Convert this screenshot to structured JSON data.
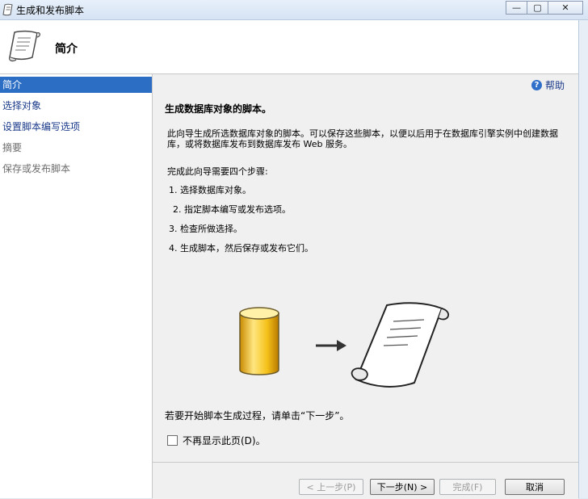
{
  "window": {
    "title": "生成和发布脚本",
    "controls": {
      "minimize": "—",
      "maximize": "▢",
      "close": "✕"
    }
  },
  "header": {
    "title": "简介"
  },
  "nav": {
    "items": [
      {
        "label": "简介",
        "state": "active"
      },
      {
        "label": "选择对象",
        "state": "link"
      },
      {
        "label": "设置脚本编写选项",
        "state": "link"
      },
      {
        "label": "摘要",
        "state": "disabled"
      },
      {
        "label": "保存或发布脚本",
        "state": "disabled"
      }
    ]
  },
  "main": {
    "help_label": "帮助",
    "heading": "生成数据库对象的脚本。",
    "paragraph": "此向导生成所选数据库对象的脚本。可以保存这些脚本，以便以后用于在数据库引擎实例中创建数据库，或将数据库发布到数据库发布 Web 服务。",
    "steps_intro": "完成此向导需要四个步骤:",
    "steps": [
      "1.  选择数据库对象。",
      "2.  指定脚本编写或发布选项。",
      "3.  检查所做选择。",
      "4.  生成脚本，然后保存或发布它们。"
    ],
    "footer_text": "若要开始脚本生成过程，请单击“下一步”。",
    "dont_show_label": "不再显示此页(D)。"
  },
  "buttons": {
    "previous": "< 上一步(P)",
    "next": "下一步(N) >",
    "finish": "完成(F)",
    "cancel": "取消"
  },
  "colors": {
    "nav_active_bg": "#2b6ec4",
    "link": "#1a3a8a",
    "help_icon": "#2f6fc9"
  }
}
